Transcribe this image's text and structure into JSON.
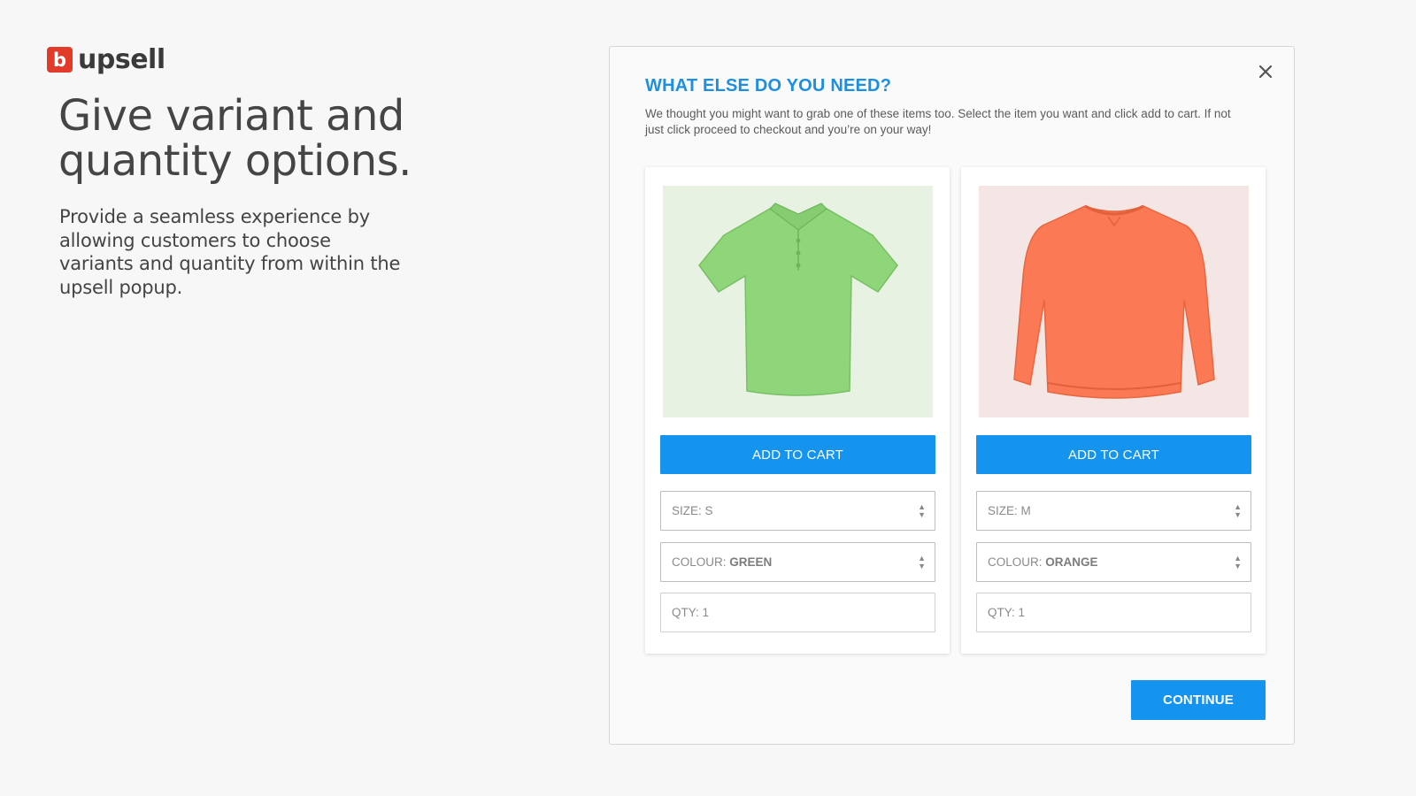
{
  "brand": {
    "logo_letter": "b",
    "name": "upsell",
    "accent": "#e23b2a"
  },
  "hero": {
    "title_line1": "Give variant and",
    "title_line2": "quantity options.",
    "description": "Provide a seamless experience by allowing customers to choose variants and quantity from within the upsell popup."
  },
  "popup": {
    "title": "WHAT ELSE DO YOU NEED?",
    "description": "We thought you might want to grab one of these items too. Select the item you want and click add to cart. If not just click proceed to checkout and you’re on your way!",
    "close_icon": "close-icon",
    "accent": "#1494ee",
    "products": [
      {
        "image_icon": "polo-shirt-image",
        "product_color": "#8fd67a",
        "add_label": "ADD TO CART",
        "size_label": "SIZE:",
        "size_value": "S",
        "colour_label": "COLOUR:",
        "colour_value": "GREEN",
        "qty_label": "QTY:",
        "qty_value": "1"
      },
      {
        "image_icon": "sweatshirt-image",
        "product_color": "#fb7a55",
        "add_label": "ADD TO CART",
        "size_label": "SIZE:",
        "size_value": "M",
        "colour_label": "COLOUR:",
        "colour_value": "ORANGE",
        "qty_label": "QTY:",
        "qty_value": "1"
      }
    ],
    "continue_label": "CONTINUE"
  }
}
